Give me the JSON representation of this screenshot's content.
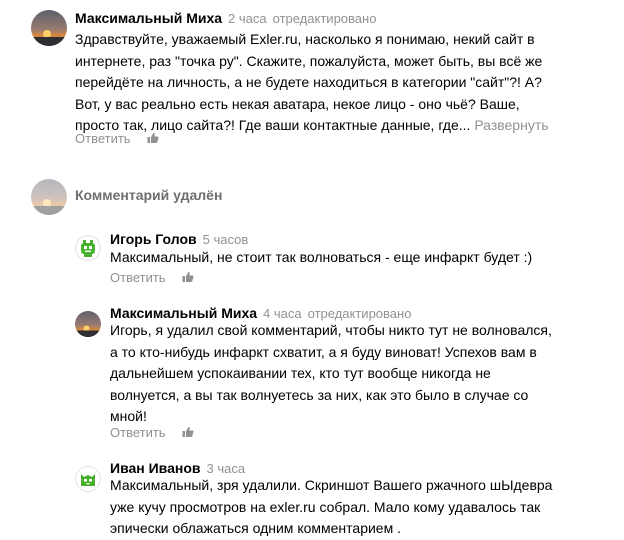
{
  "comments": [
    {
      "author": "Максимальный Миха",
      "time": "2 часа",
      "edited": "отредактировано",
      "lines": [
        "Здравствуйте, уважаемый Exler.ru, насколько я понимаю, некий сайт в",
        "интернете, раз \"точка ру\". Скажите, пожалуйста, может быть, вы всё же",
        "перейдёте на личность, а не будете находиться в категории \"сайт\"?! А?",
        "Вот, у вас реально есть некая аватара, некое лицо - оно чьё? Ваше,",
        "просто так, лицо сайта?! Где ваши контактные данные, где..."
      ],
      "expand": "Развернуть",
      "reply": "Ответить",
      "avatar": "sunset-avatar"
    },
    {
      "deleted_label": "Комментарий удалён",
      "avatar": "sunset-avatar-faded"
    },
    {
      "author": "Игорь Голов",
      "time": "5 часов",
      "lines": [
        "Максимальный, не стоит так волноваться - еще инфаркт будет :)"
      ],
      "reply": "Ответить",
      "avatar": "green-robot-avatar"
    },
    {
      "author": "Максимальный Миха",
      "time": "4 часа",
      "edited": "отредактировано",
      "lines": [
        "Игорь, я удалил свой комментарий, чтобы никто тут не волновался,",
        "а то кто-нибудь инфаркт схватит, а я буду виноват! Успехов вам в",
        "дальнейшем успокаивании тех, кто тут вообще никогда не",
        "волнуется, а вы так волнуетесь за них, как это было в случае со",
        "мной!"
      ],
      "reply": "Ответить",
      "avatar": "sunset-avatar"
    },
    {
      "author": "Иван Иванов",
      "time": "3 часа",
      "lines": [
        "Максимальный, зря удалили. Скриншот Вашего ржачного шЫдевра",
        "уже кучу просмотров на exler.ru собрал. Мало кому удавалось так",
        "эпически облажаться одним комментарием ."
      ],
      "avatar": "green-cat-avatar"
    }
  ],
  "colors": {
    "muted": "#919191",
    "accent_green": "#48b02c",
    "deleted_text": "#6f6f6f"
  }
}
